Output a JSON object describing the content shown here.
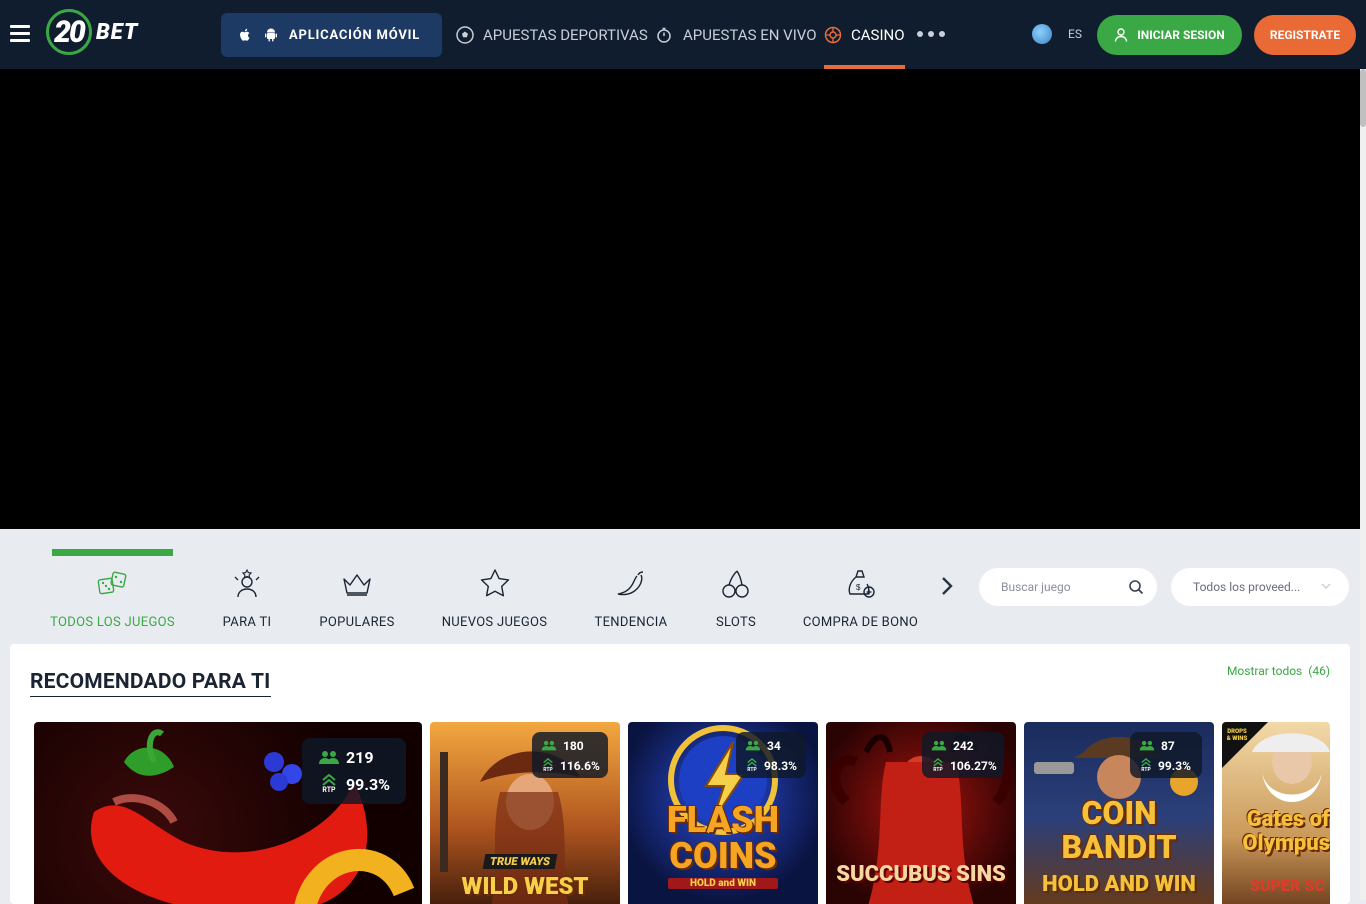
{
  "header": {
    "logo_number": "20",
    "logo_text": "BET",
    "app_button_label": "APLICACIÓN MÓVIL",
    "nav": [
      {
        "label": "APUESTAS DEPORTIVAS",
        "icon": "soccer-ball-icon",
        "active": false
      },
      {
        "label": "APUESTAS EN VIVO",
        "icon": "stopwatch-icon",
        "active": false
      },
      {
        "label": "CASINO",
        "icon": "roulette-icon",
        "active": true
      }
    ],
    "language": "ES",
    "login_label": "INICIAR SESION",
    "register_label": "REGISTRATE",
    "colors": {
      "bg": "#101d2e",
      "green": "#3aa845",
      "orange": "#ea6a35",
      "app_btn": "#1c3a63"
    }
  },
  "categories": {
    "items": [
      {
        "label": "TODOS LOS JUEGOS",
        "icon": "dice-icon",
        "active": true
      },
      {
        "label": "PARA TI",
        "icon": "user-star-icon",
        "active": false
      },
      {
        "label": "POPULARES",
        "icon": "crown-icon",
        "active": false
      },
      {
        "label": "NUEVOS JUEGOS",
        "icon": "star-icon",
        "active": false
      },
      {
        "label": "TENDENCIA",
        "icon": "chili-pepper-icon",
        "active": false
      },
      {
        "label": "SLOTS",
        "icon": "cherries-icon",
        "active": false
      },
      {
        "label": "COMPRA DE BONO",
        "icon": "money-bag-icon",
        "active": false
      }
    ],
    "search_placeholder": "Buscar juego",
    "provider_selected": "Todos los proveed..."
  },
  "recommended": {
    "title": "RECOMENDADO PARA TI",
    "show_all_label": "Mostrar todos",
    "show_all_count": "(46)",
    "rtp_label": "RTP",
    "games": [
      {
        "players": "219",
        "rtp": "99.3%",
        "name": ""
      },
      {
        "players": "180",
        "rtp": "116.6%",
        "name": "WILD WEST",
        "tag": "TRUE WAYS"
      },
      {
        "players": "34",
        "rtp": "98.3%",
        "name": "FLASH COINS",
        "tag": "HOLD and WIN"
      },
      {
        "players": "242",
        "rtp": "106.27%",
        "name": "SUCCUBUS SINS"
      },
      {
        "players": "87",
        "rtp": "99.3%",
        "name": "COIN BANDIT",
        "tag": "HOLD AND WIN"
      },
      {
        "players": "",
        "rtp": "",
        "name": "Gates of Olympus",
        "tag": "SUPER SC",
        "badge": "DROPS & WINS"
      }
    ]
  }
}
